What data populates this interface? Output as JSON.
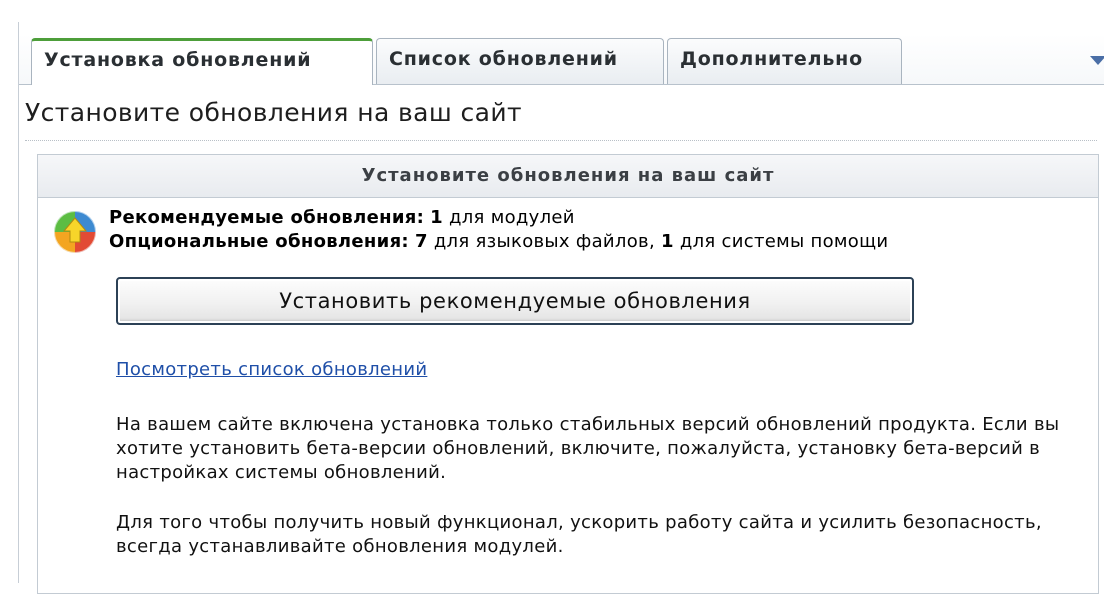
{
  "tabs": [
    {
      "label": "Установка обновлений",
      "active": true
    },
    {
      "label": "Список обновлений",
      "active": false
    },
    {
      "label": "Дополнительно",
      "active": false
    }
  ],
  "page_title": "Установите обновления на ваш сайт",
  "panel": {
    "header": "Установите обновления на ваш сайт",
    "recommended": {
      "label": "Рекомендуемые обновления:",
      "count": "1",
      "suffix": "для модулей"
    },
    "optional": {
      "label": "Опциональные обновления:",
      "count1": "7",
      "mid": "для языковых файлов,",
      "count2": "1",
      "suffix": "для системы помощи"
    },
    "install_button": "Установить рекомендуемые обновления",
    "view_list_link": "Посмотреть список обновлений",
    "note_beta": "На вашем сайте включена установка только стабильных версий обновлений продукта. Если вы хотите установить бета-версии обновлений, включите, пожалуйста, установку бета-версий в настройках системы обновлений.",
    "note_modules": "Для того чтобы получить новый функционал, ускорить работу сайта и усилить безопасность, всегда устанавливайте обновления модулей."
  },
  "colors": {
    "active_tab_accent": "#4d9e3a",
    "link": "#1f4fa8",
    "menu_arrow": "#4a6ea6"
  },
  "icons": {
    "updates": "updates-globe-icon",
    "menu": "dropdown-arrow-icon"
  }
}
